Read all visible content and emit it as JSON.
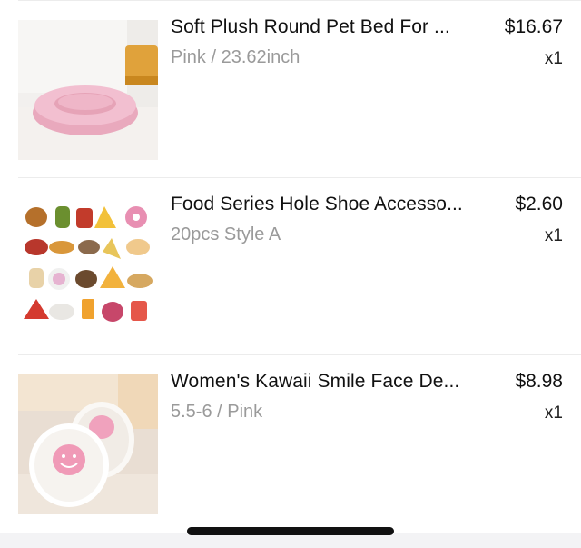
{
  "cart": {
    "items": [
      {
        "title": "Soft Plush Round Pet Bed For ...",
        "variant": "Pink / 23.62inch",
        "price": "$16.67",
        "quantity": "x1",
        "image": "pink-plush-pet-bed-image"
      },
      {
        "title": "Food Series Hole Shoe Accesso...",
        "variant": "20pcs Style A",
        "price": "$2.60",
        "quantity": "x1",
        "image": "food-shoe-charms-image"
      },
      {
        "title": "Women's Kawaii Smile Face De...",
        "variant": "5.5-6 / Pink",
        "price": "$8.98",
        "quantity": "x1",
        "image": "smile-face-slippers-image"
      }
    ]
  },
  "colors": {
    "title": "#111111",
    "variant": "#9a9a9a",
    "divider": "#ececec",
    "bottom_band": "#f3f3f5"
  }
}
